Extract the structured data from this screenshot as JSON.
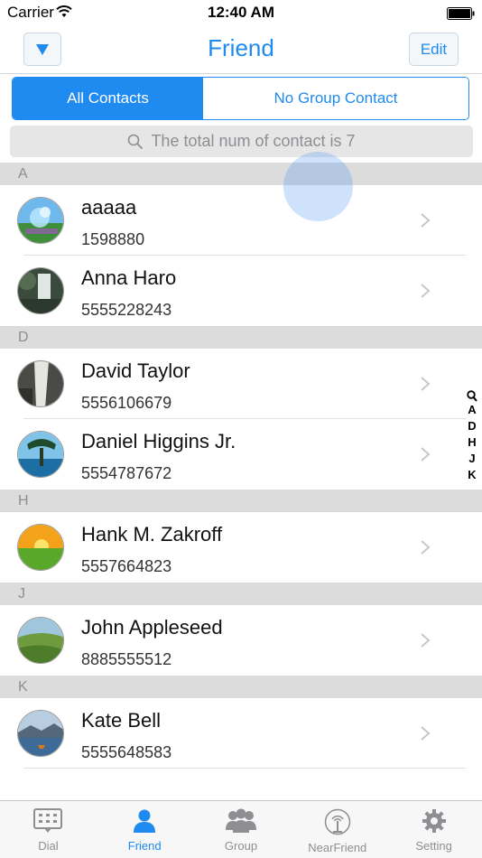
{
  "status_bar": {
    "carrier": "Carrier",
    "time": "12:40 AM"
  },
  "nav": {
    "title": "Friend",
    "edit_label": "Edit"
  },
  "segments": {
    "all_contacts": "All Contacts",
    "no_group": "No Group Contact"
  },
  "search": {
    "summary": "The total num of contact is 7"
  },
  "sections": [
    {
      "letter": "A",
      "contacts": [
        {
          "name": "aaaaa",
          "phone": "1598880"
        },
        {
          "name": "Anna Haro",
          "phone": "5555228243"
        }
      ]
    },
    {
      "letter": "D",
      "contacts": [
        {
          "name": "David Taylor",
          "phone": "5556106679"
        },
        {
          "name": "Daniel Higgins Jr.",
          "phone": "5554787672"
        }
      ]
    },
    {
      "letter": "H",
      "contacts": [
        {
          "name": "Hank M. Zakroff",
          "phone": "5557664823"
        }
      ]
    },
    {
      "letter": "J",
      "contacts": [
        {
          "name": "John Appleseed",
          "phone": "8885555512"
        }
      ]
    },
    {
      "letter": "K",
      "contacts": [
        {
          "name": "Kate Bell",
          "phone": "5555648583"
        }
      ]
    }
  ],
  "index": [
    "A",
    "D",
    "H",
    "J",
    "K"
  ],
  "tabs": [
    {
      "label": "Dial",
      "icon": "dial-icon"
    },
    {
      "label": "Friend",
      "icon": "person-icon"
    },
    {
      "label": "Group",
      "icon": "group-icon"
    },
    {
      "label": "NearFriend",
      "icon": "antenna-icon"
    },
    {
      "label": "Setting",
      "icon": "gear-icon"
    }
  ],
  "colors": {
    "accent": "#1f8aef",
    "section_bg": "#dcdcdc",
    "muted": "#8e8e93"
  }
}
